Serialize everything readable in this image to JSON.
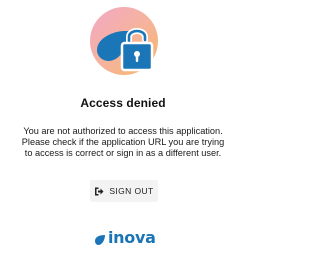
{
  "access": {
    "title": "Access denied",
    "message_lines": [
      "You are not authorized to access this application.",
      "Please check if the application URL you are trying",
      "to access is correct or sign in as a different user."
    ],
    "signout_label": "SIGN OUT",
    "signout_icon": "sign-out-icon"
  },
  "hero": {
    "icon": "locked-padlock-illustration-icon",
    "gradient_colors": [
      "#f3b6c8",
      "#f7b26f"
    ],
    "drop_color": "#1b76b8",
    "lock_color": "#1b76b8"
  },
  "brand": {
    "name": "inova",
    "logo_icon": "inova-drop-logo-icon",
    "color": "#1a74b8"
  }
}
